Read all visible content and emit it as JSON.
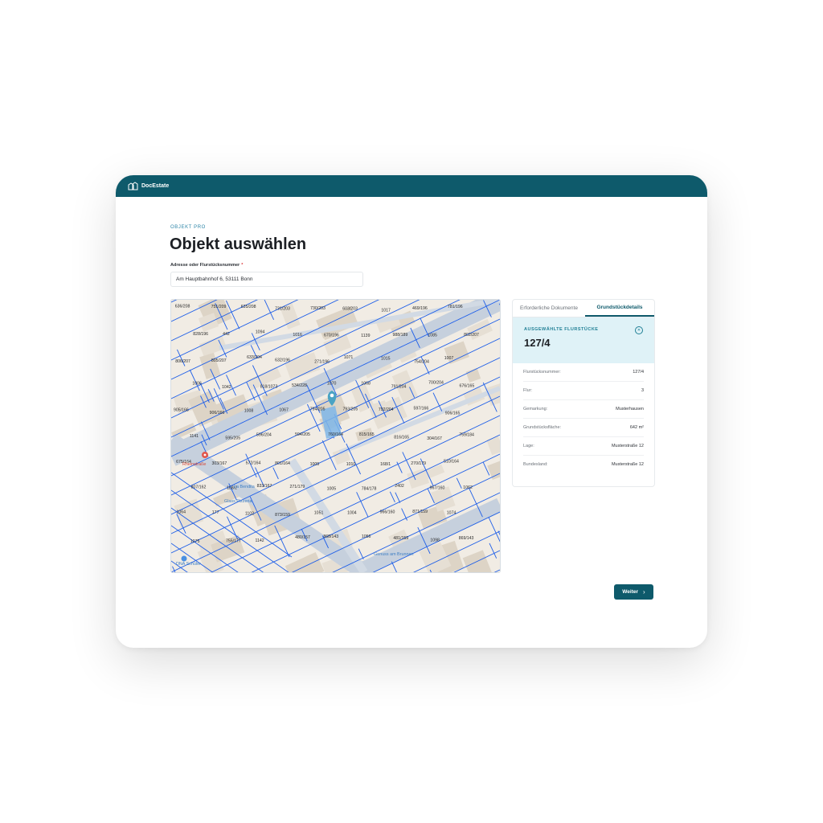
{
  "app": {
    "brand": "DocEstate"
  },
  "page": {
    "eyebrow": "OBJEKT PRO",
    "title": "Objekt auswählen",
    "address_label": "Adresse oder Flurstücksnummer",
    "required_marker": "*",
    "address_value": "Am Hauptbahnhof 6, 53111 Bonn"
  },
  "panel": {
    "tabs": [
      {
        "label": "Erforderliche Dokumente",
        "active": false
      },
      {
        "label": "Grundstückdetails",
        "active": true
      }
    ],
    "selected_label": "AUSGEWÄHLTE FLURSTÜCKE",
    "selected_value": "127/4",
    "details": [
      {
        "label": "Flurstücksnummer:",
        "value": "127/4"
      },
      {
        "label": "Flur:",
        "value": "3"
      },
      {
        "label": "Gemarkung:",
        "value": "Musterhausen"
      },
      {
        "label": "Grundstücksfläche:",
        "value": "642 m²"
      },
      {
        "label": "Lage:",
        "value": "Musterstraße 12"
      },
      {
        "label": "Bundesland:",
        "value": "Musterstraße 12"
      }
    ]
  },
  "map": {
    "parcel_labels": [
      "636/208",
      "751/209",
      "635/208",
      "731/203",
      "730/203",
      "603/203",
      "1017",
      "469/196",
      "781/196",
      "828/196",
      "442",
      "1094",
      "1016",
      "670/196",
      "1139",
      "988/189",
      "1085",
      "802/207",
      "806/207",
      "805/207",
      "633/204",
      "632/196",
      "271/196",
      "1071",
      "1015",
      "754/204",
      "1007",
      "1006",
      "1042",
      "818/1073",
      "534/228",
      "1070",
      "1068",
      "791/204",
      "700/204",
      "676/165",
      "905/166",
      "906/166",
      "1008",
      "1067",
      "794/205",
      "793/205",
      "792/204",
      "597/166",
      "906/165",
      "1141",
      "595/205",
      "596/204",
      "594/205",
      "760/164",
      "815/165",
      "816/165",
      "304/167",
      "759/184",
      "675/164",
      "303/167",
      "572/164",
      "801/164",
      "1009",
      "1010",
      "168/1",
      "270/179",
      "510/164",
      "807/162",
      "168/2",
      "833/167",
      "271/179",
      "1005",
      "784/178",
      "2402",
      "967/160",
      "1062",
      "1064",
      "177",
      "1102",
      "873/159",
      "1051",
      "1004",
      "966/160",
      "871/159",
      "1074",
      "1075",
      "755/177",
      "1142",
      "480/157",
      "868/143",
      "1056",
      "481/159",
      "1098",
      "869/143"
    ],
    "street_labels": [
      "Rheinstraße",
      "La Bendita",
      "Glass Pizzeria",
      "Genuss am Brunnen",
      "DNA Schüler"
    ],
    "colors": {
      "parcel_line": "#1f5fe8",
      "road": "#c9d3e0",
      "building": "#ddd5c8",
      "highlight": "#7fb6e8",
      "pin": "#4aa3c4"
    }
  },
  "actions": {
    "next_label": "Weiter",
    "next_icon": "chevron-right-icon"
  },
  "colors": {
    "brand": "#0e5a6b",
    "accent": "#1f7f95"
  }
}
